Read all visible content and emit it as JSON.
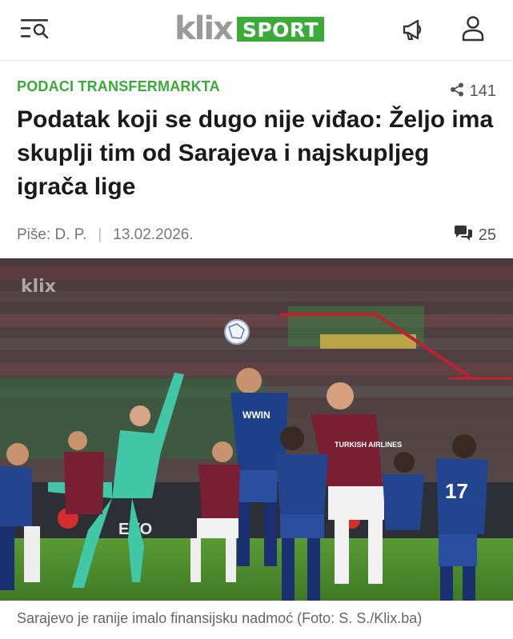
{
  "header": {
    "logo_text": "klix",
    "logo_section": "SPORT",
    "menu_icon": "menu-search-icon",
    "notify_icon": "megaphone-icon",
    "account_icon": "user-icon"
  },
  "article": {
    "category": "PODACI TRANSFERMARKTA",
    "share_count": "141",
    "title": "Podatak koji se dugo nije viđao: Željo ima skuplji tim od Sarajeva i najskupljeg igrača lige",
    "author": "Piše: D. P.",
    "separator": "|",
    "date": "13.02.2026.",
    "comment_count": "25",
    "photo_watermark": "klix",
    "photo_ad_text": "EVO",
    "player_sponsor_1": "WWIN",
    "player_sponsor_2": "TURKISH AIRLINES",
    "player_number": "17",
    "caption": "Sarajevo je ranije imalo finansijsku nadmoć (Foto: S. S./Klix.ba)"
  },
  "colors": {
    "brand_green": "#3aab39",
    "logo_gray": "#9a9a9a",
    "maroon_kit": "#7a1f33",
    "blue_kit": "#1e3f8a",
    "keeper_kit": "#41c7a6",
    "pitch": "#4f8d2e"
  }
}
